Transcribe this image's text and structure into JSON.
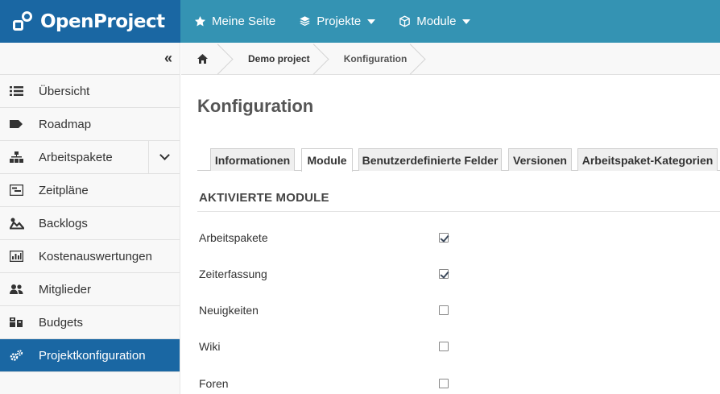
{
  "app": {
    "logo_text": "OpenProject"
  },
  "topnav": {
    "items": [
      {
        "label": "Meine Seite",
        "icon": "star-icon"
      },
      {
        "label": "Projekte",
        "icon": "layers-icon"
      },
      {
        "label": "Module",
        "icon": "cube-icon"
      }
    ]
  },
  "sidebar": {
    "items": [
      {
        "label": "Übersicht",
        "icon": "list-icon"
      },
      {
        "label": "Roadmap",
        "icon": "tag-icon"
      },
      {
        "label": "Arbeitspakete",
        "icon": "hierarchy-icon"
      },
      {
        "label": "Zeitpläne",
        "icon": "timeline-icon"
      },
      {
        "label": "Backlogs",
        "icon": "backlogs-icon"
      },
      {
        "label": "Kostenauswertungen",
        "icon": "chart-icon"
      },
      {
        "label": "Mitglieder",
        "icon": "group-icon"
      },
      {
        "label": "Budgets",
        "icon": "budget-icon"
      },
      {
        "label": "Projektkonfiguration",
        "icon": "gears-icon"
      }
    ]
  },
  "breadcrumb": {
    "items": [
      {
        "label": "Demo project"
      },
      {
        "label": "Konfiguration"
      }
    ]
  },
  "main": {
    "title": "Konfiguration",
    "tabs": [
      {
        "label": "Informationen"
      },
      {
        "label": "Module"
      },
      {
        "label": "Benutzerdefinierte Felder"
      },
      {
        "label": "Versionen"
      },
      {
        "label": "Arbeitspaket-Kategorien"
      }
    ],
    "active_tab": "Module",
    "section_title": "AKTIVIERTE MODULE",
    "modules": [
      {
        "label": "Arbeitspakete",
        "checked": true
      },
      {
        "label": "Zeiterfassung",
        "checked": true
      },
      {
        "label": "Neuigkeiten",
        "checked": false
      },
      {
        "label": "Wiki",
        "checked": false
      },
      {
        "label": "Foren",
        "checked": false
      }
    ]
  },
  "colors": {
    "header_bg": "#3493b3",
    "logo_bg": "#1a67a3",
    "active_item_bg": "#1a67a3",
    "sidebar_bg": "#f8f8f8"
  }
}
